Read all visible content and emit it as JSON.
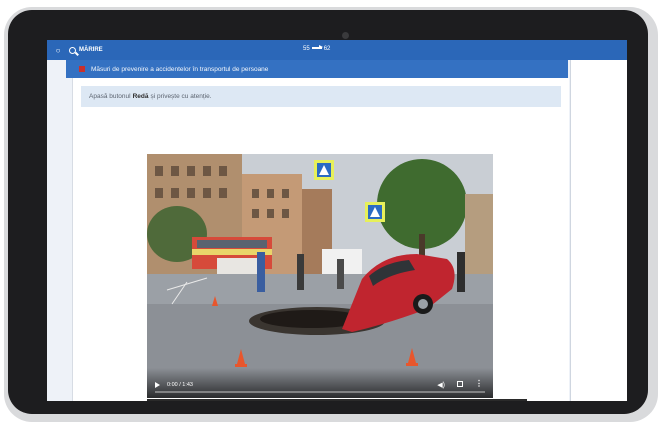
{
  "topbar": {
    "zoom_label": "MĂRIRE",
    "page_current": "55",
    "page_next": "62"
  },
  "lesson": {
    "title": "Măsuri de prevenire a accidentelor în transportul de persoane"
  },
  "instruction": {
    "prefix": "Apasă butonul",
    "button_name": "Redă",
    "suffix": "și privește cu atenție."
  },
  "video": {
    "time": "0:00 / 1:43",
    "progress": 0
  },
  "colors": {
    "topbar": "#2b67b8",
    "lesson_bar": "#3471c2",
    "instruction_bg": "#dde8f4",
    "car": "#c0252f"
  },
  "icons": {
    "zoom": "magnifier-icon",
    "play": "play-icon",
    "volume": "volume-icon",
    "fullscreen": "fullscreen-icon",
    "more": "more-options-icon"
  }
}
